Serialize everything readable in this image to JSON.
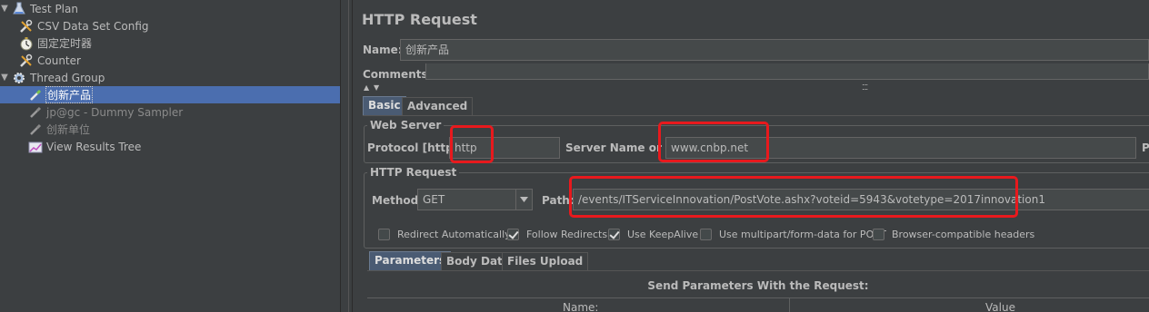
{
  "tree": {
    "items": [
      {
        "label": "Test Plan",
        "icon": "flask-icon",
        "arrow": "▼"
      },
      {
        "label": "CSV Data Set Config",
        "icon": "wrench-icon"
      },
      {
        "label": "固定定时器",
        "icon": "stopwatch-icon"
      },
      {
        "label": "Counter",
        "icon": "wrench-icon"
      },
      {
        "label": "Thread Group",
        "icon": "gear-icon",
        "arrow": "▼"
      },
      {
        "label": "创新产品",
        "icon": "pipette-icon",
        "selected": true
      },
      {
        "label": "jp@gc - Dummy Sampler",
        "icon": "pipette-icon",
        "disabled": true
      },
      {
        "label": "创新单位",
        "icon": "pipette-icon",
        "disabled": true
      },
      {
        "label": "View Results Tree",
        "icon": "chart-icon"
      }
    ]
  },
  "main": {
    "title": "HTTP Request",
    "name_label": "Name:",
    "name_value": "创新产品",
    "comments_label": "Comments:",
    "tabs": [
      "Basic",
      "Advanced"
    ],
    "web_server": {
      "title": "Web Server",
      "protocol_label": "Protocol [http]:",
      "protocol_value": "http",
      "server_label": "Server Name or IP:",
      "server_value": "www.cnbp.net",
      "port_label_partial": "P"
    },
    "http_request": {
      "title": "HTTP Request",
      "method_label": "Method:",
      "method_value": "GET",
      "path_label": "Path:",
      "path_value": "/events/ITServiceInnovation/PostVote.ashx?voteid=5943&votetype=2017innovation1"
    },
    "options": [
      {
        "label": "Redirect Automatically",
        "checked": false
      },
      {
        "label": "Follow Redirects",
        "checked": true
      },
      {
        "label": "Use KeepAlive",
        "checked": true
      },
      {
        "label": "Use multipart/form-data for POST",
        "checked": false
      },
      {
        "label": "Browser-compatible headers",
        "checked": false
      }
    ],
    "sub_tabs": [
      "Parameters",
      "Body Data",
      "Files Upload"
    ],
    "params_title": "Send Parameters With the Request:",
    "columns": [
      "Name:",
      "Value"
    ]
  },
  "colors": {
    "background": "#3c3f41",
    "selection": "#4b6eaf",
    "highlight_box": "#e8191d"
  }
}
